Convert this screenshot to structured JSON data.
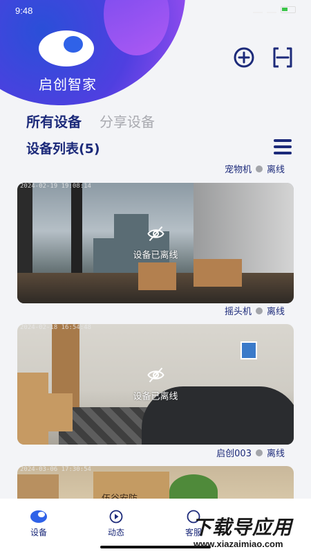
{
  "status_bar": {
    "time": "9:48"
  },
  "app": {
    "name": "启创智家"
  },
  "tabs": [
    {
      "label": "所有设备",
      "active": true
    },
    {
      "label": "分享设备",
      "active": false
    }
  ],
  "device_list": {
    "title": "设备列表(5)",
    "devices": [
      {
        "name": "宠物机",
        "status": "离线"
      },
      {
        "name": "摇头机",
        "status": "离线",
        "timestamp": "2024-02-19 19:08:14",
        "overlay": "设备已离线"
      },
      {
        "name": "启创003",
        "status": "离线",
        "timestamp": "2024-02-18 16:54:48",
        "overlay": "设备已离线"
      },
      {
        "timestamp": "2024-03-06 17:30:54"
      }
    ],
    "snapshot_text": "伍谷安防"
  },
  "bottom_nav": [
    {
      "label": "设备",
      "icon": "device-icon",
      "active": true
    },
    {
      "label": "动态",
      "icon": "play-icon",
      "active": false
    },
    {
      "label": "客服",
      "icon": "service-icon",
      "active": false
    }
  ],
  "watermark": {
    "title": "下载导应用",
    "url": "www.xiazaimiao.com"
  },
  "colors": {
    "accent": "#1c2a7a",
    "brand_gradient_start": "#2a4fd8",
    "brand_gradient_end": "#b35ff3"
  }
}
